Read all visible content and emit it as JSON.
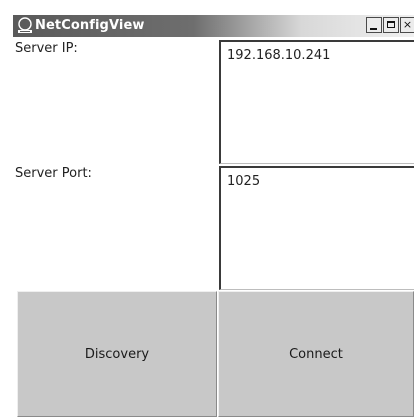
{
  "window": {
    "title": "NetConfigView",
    "icon": "app-logo-icon",
    "controls": {
      "minimize": "minimize-icon",
      "maximize": "maximize-icon",
      "close": "close-icon"
    },
    "close_glyph": "×"
  },
  "form": {
    "server_ip_label": "Server IP:",
    "server_ip_value": "192.168.10.241",
    "server_port_label": "Server Port:",
    "server_port_value": "1025"
  },
  "buttons": {
    "discovery": "Discovery",
    "connect": "Connect"
  },
  "colors": {
    "titlebar_dark": "#5a5a5a",
    "button_face": "#c8c8c8"
  }
}
